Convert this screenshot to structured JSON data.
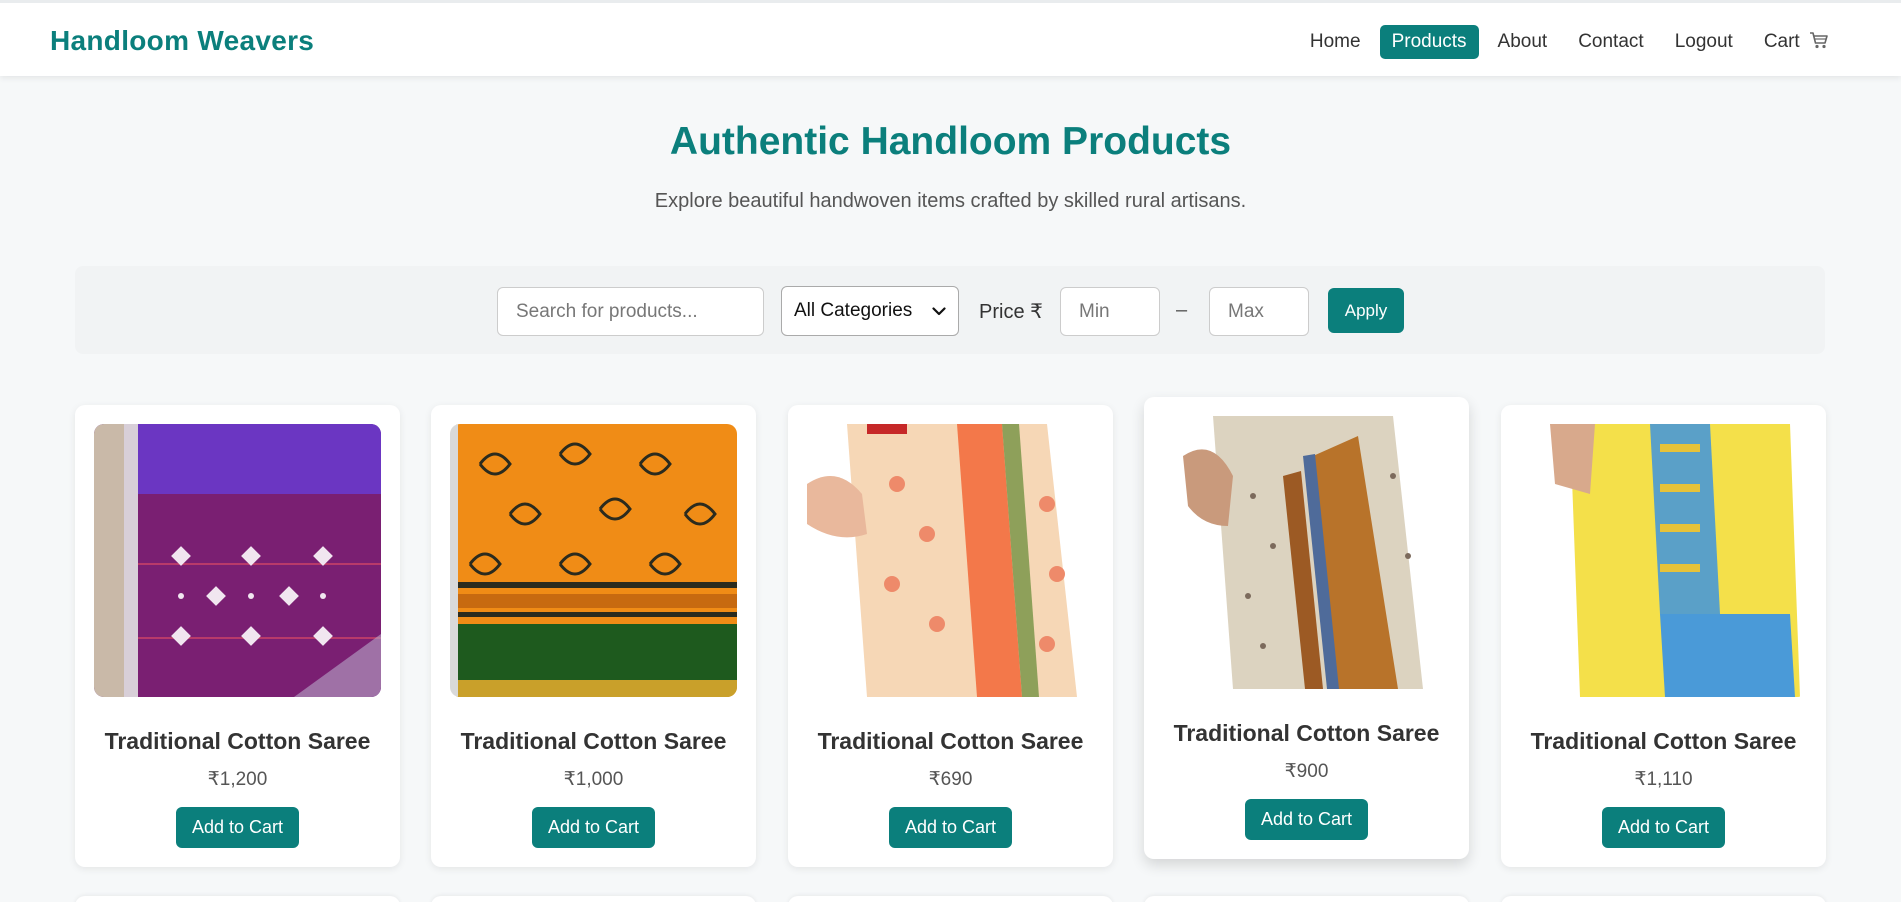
{
  "navbar": {
    "brand": "Handloom Weavers",
    "links": [
      {
        "label": "Home",
        "active": false
      },
      {
        "label": "Products",
        "active": true
      },
      {
        "label": "About",
        "active": false
      },
      {
        "label": "Contact",
        "active": false
      },
      {
        "label": "Logout",
        "active": false
      }
    ],
    "cart_label": "Cart",
    "cart_icon": "shopping-cart-icon"
  },
  "hero": {
    "title": "Authentic Handloom Products",
    "subtitle": "Explore beautiful handwoven items crafted by skilled rural artisans."
  },
  "filters": {
    "search_placeholder": "Search for products...",
    "category_selected": "All Categories",
    "price_label": "Price ₹",
    "min_placeholder": "Min",
    "separator": "–",
    "max_placeholder": "Max",
    "apply_label": "Apply"
  },
  "products": [
    {
      "name": "Traditional Cotton Saree",
      "price": "₹1,200",
      "button": "Add to Cart",
      "image_icon": "purple-saree-image"
    },
    {
      "name": "Traditional Cotton Saree",
      "price": "₹1,000",
      "button": "Add to Cart",
      "image_icon": "orange-saree-image"
    },
    {
      "name": "Traditional Cotton Saree",
      "price": "₹690",
      "button": "Add to Cart",
      "image_icon": "peach-saree-image"
    },
    {
      "name": "Traditional Cotton Saree",
      "price": "₹900",
      "button": "Add to Cart",
      "image_icon": "beige-saree-image"
    },
    {
      "name": "Traditional Cotton Saree",
      "price": "₹1,110",
      "button": "Add to Cart",
      "image_icon": "yellow-saree-image"
    }
  ],
  "colors": {
    "accent": "#0b7f7c",
    "background": "#f6f8f9"
  }
}
